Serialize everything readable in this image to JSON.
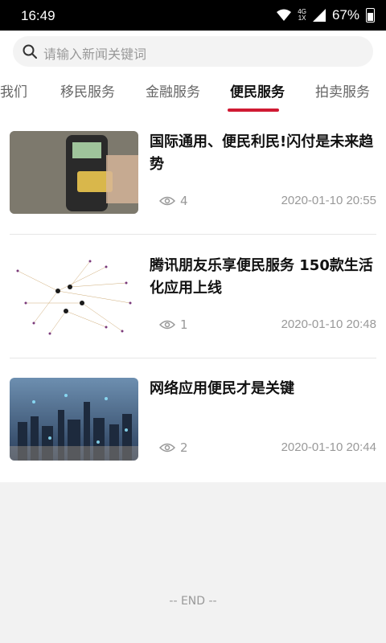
{
  "status": {
    "time": "16:49",
    "network_top": "4G",
    "network_bottom": "1X",
    "battery": "67%"
  },
  "search": {
    "placeholder": "请输入新闻关键词"
  },
  "tabs": [
    {
      "label": "关于我们"
    },
    {
      "label": "移民服务"
    },
    {
      "label": "金融服务"
    },
    {
      "label": "便民服务",
      "active": true
    },
    {
      "label": "拍卖服务"
    }
  ],
  "articles": [
    {
      "title": "国际通用、便民利民!闪付是未来趋势",
      "views": "4",
      "date": "2020-01-10 20:55"
    },
    {
      "title": "腾讯朋友乐享便民服务 150款生活化应用上线",
      "views": "1",
      "date": "2020-01-10 20:48"
    },
    {
      "title": "网络应用便民才是关键",
      "views": "2",
      "date": "2020-01-10 20:44"
    }
  ],
  "footer": {
    "end_text": "-- END --"
  },
  "colors": {
    "accent": "#d01a33",
    "muted": "#999999"
  }
}
